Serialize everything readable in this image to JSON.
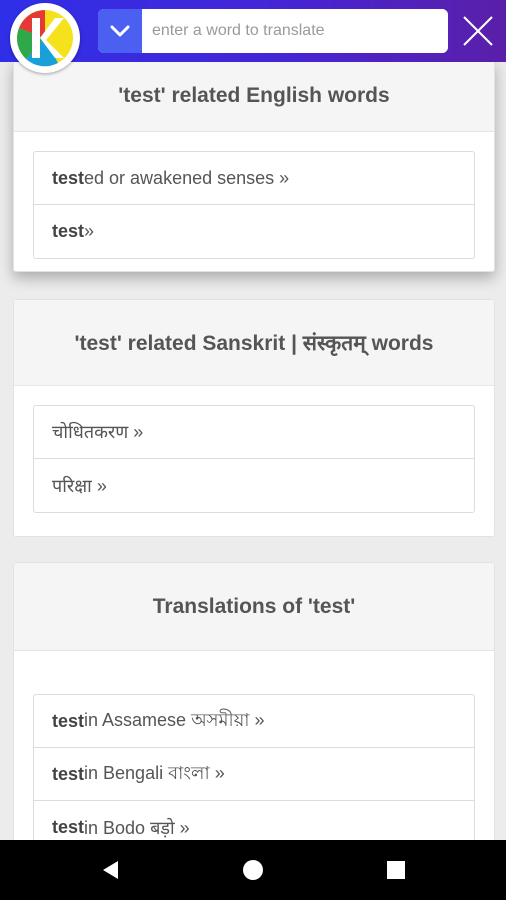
{
  "search": {
    "placeholder": "enter a word to translate"
  },
  "cards": {
    "english": {
      "title": "'test' related English words",
      "items": [
        {
          "bold": "test",
          "rest": "ed or awakened senses »"
        },
        {
          "bold": "test",
          "rest": " »"
        }
      ]
    },
    "sanskrit": {
      "title": "'test' related Sanskrit | संस्कृतम् words",
      "items": [
        {
          "text": "चोधितकरण »"
        },
        {
          "text": "परिक्षा »"
        }
      ]
    },
    "translations": {
      "title": "Translations of 'test'",
      "items": [
        {
          "bold": "test",
          "rest": " in Assamese অসমীয়া »"
        },
        {
          "bold": "test",
          "rest": " in Bengali বাংলা »"
        },
        {
          "bold": "test",
          "rest": " in Bodo बड़ो »"
        }
      ]
    }
  },
  "icons": {
    "logo": "k-logo-icon",
    "lang": "chevron-down-icon",
    "close": "close-icon",
    "nav": [
      "back-icon",
      "home-icon",
      "recents-icon"
    ]
  },
  "colors": {
    "topbar_start": "#2f2fe8",
    "topbar_end": "#5a1fa8",
    "lang_button": "#4b5ff0"
  }
}
